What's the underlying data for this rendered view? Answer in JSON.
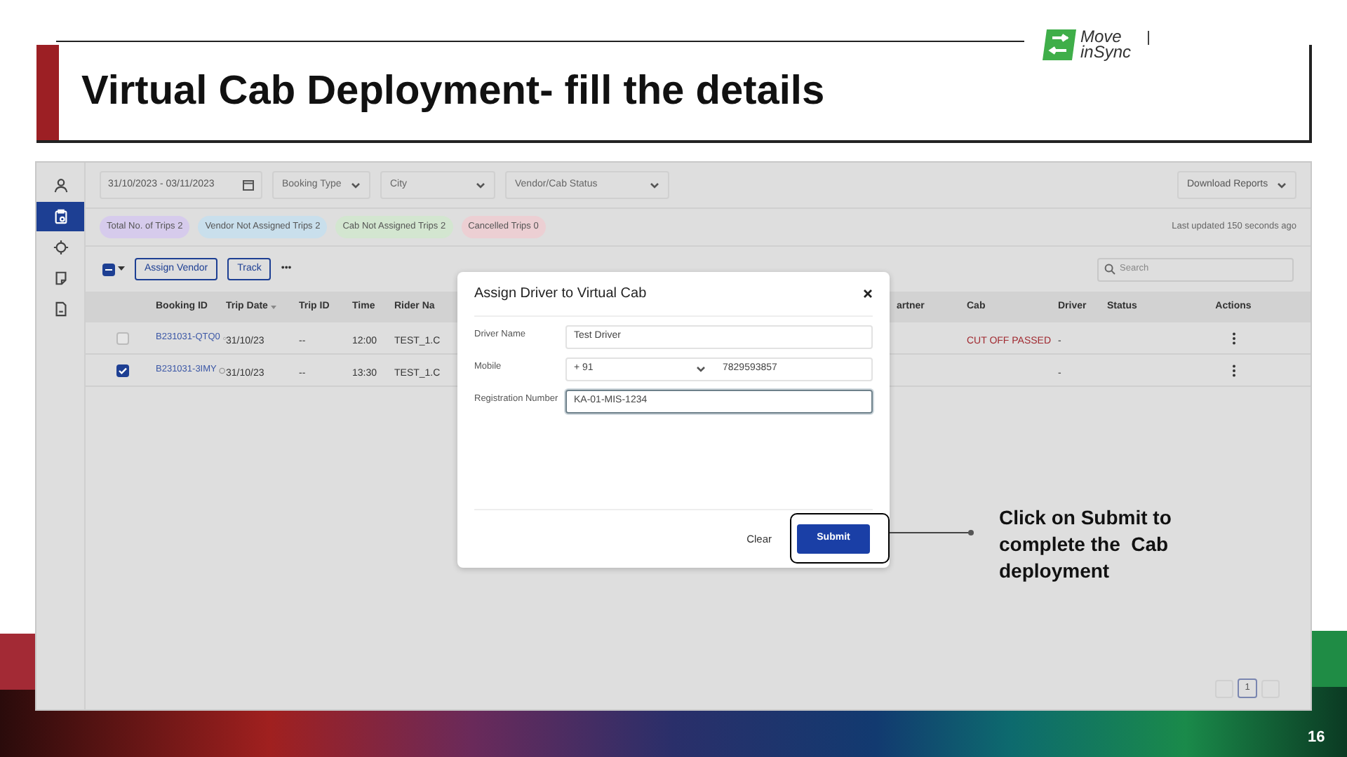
{
  "slide": {
    "title": "Virtual Cab Deployment- fill the details",
    "page_number": "16",
    "logo": {
      "line1": "Move",
      "line2": "inSync"
    }
  },
  "sidebar": {
    "items": [
      {
        "selected": false
      },
      {
        "selected": true
      },
      {
        "selected": false
      },
      {
        "selected": false
      },
      {
        "selected": false
      }
    ]
  },
  "filters": [
    {
      "kind": "date",
      "value": "31/10/2023 - 03/11/2023"
    },
    {
      "kind": "select",
      "placeholder": "Booking Type"
    },
    {
      "kind": "select",
      "placeholder": "City"
    },
    {
      "kind": "select",
      "placeholder": "Vendor/Cab Status"
    }
  ],
  "download_button": "Download Reports",
  "chips": [
    {
      "label": "Total No. of Trips 2",
      "color": "#d6cbec"
    },
    {
      "label": "Vendor Not Assigned Trips 2",
      "color": "#c9dfec"
    },
    {
      "label": "Cab Not Assigned Trips 2",
      "color": "#d3e6d0"
    },
    {
      "label": "Cancelled Trips 0",
      "color": "#eccfd3"
    }
  ],
  "last_updated": "Last updated 150 seconds ago",
  "toolbar": {
    "select_all_indeterminate": true,
    "buttons": [
      "Assign Vendor",
      "Track"
    ],
    "more": "•••",
    "search": {
      "placeholder": "Search"
    }
  },
  "table": {
    "columns": [
      "Booking ID",
      "Trip Date",
      "Trip ID",
      "Time",
      "Rider Na",
      "artner",
      "Cab",
      "Driver",
      "Status",
      "Actions"
    ],
    "rows": [
      {
        "checked": false,
        "booking_id": "B231031-QTQ0",
        "trip_date": "31/10/23",
        "trip_id": "--",
        "time": "12:00",
        "rider": "TEST_1.C",
        "cab": "CUT OFF PASSED",
        "driver": "-"
      },
      {
        "checked": true,
        "booking_id": "B231031-3IMY",
        "trip_date": "31/10/23",
        "trip_id": "--",
        "time": "13:30",
        "rider": "TEST_1.C",
        "driver": "-"
      }
    ]
  },
  "modal": {
    "title": "Assign Driver to Virtual Cab",
    "fields": [
      {
        "kind": "text",
        "label": "Driver Name",
        "value": "Test Driver",
        "focused": false
      },
      {
        "kind": "phone",
        "label": "Mobile",
        "code": "+ 91",
        "value": "7829593857"
      },
      {
        "kind": "text",
        "label": "Registration Number",
        "value": "KA-01-MIS-1234",
        "focused": true
      }
    ],
    "clear": "Clear",
    "submit": "Submit"
  },
  "callout": "Click on Submit to complete the  Cab deployment",
  "pagination": {
    "pages": [
      {
        "label": "1",
        "selected": true
      }
    ]
  }
}
